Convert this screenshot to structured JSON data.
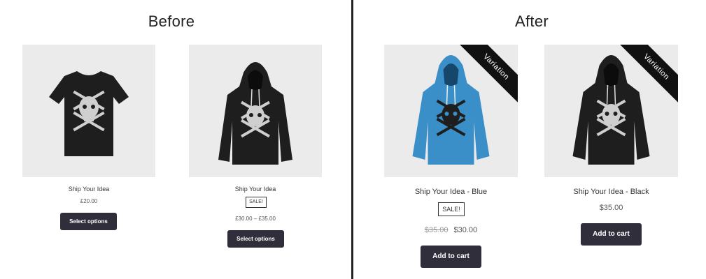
{
  "before": {
    "title": "Before",
    "products": [
      {
        "image": "tshirt-black",
        "name": "Ship Your Idea",
        "price": "£20.00",
        "button": "Select options"
      },
      {
        "image": "hoodie-black",
        "name": "Ship Your Idea",
        "sale_badge": "SALE!",
        "price": "£30.00 – £35.00",
        "button": "Select options"
      }
    ]
  },
  "after": {
    "title": "After",
    "products": [
      {
        "image": "hoodie-blue",
        "ribbon": "Variation",
        "name": "Ship Your Idea - Blue",
        "sale_badge": "SALE!",
        "old_price": "$35.00",
        "price": "$30.00",
        "button": "Add to cart"
      },
      {
        "image": "hoodie-black",
        "ribbon": "Variation",
        "name": "Ship Your Idea - Black",
        "price": "$35.00",
        "button": "Add to cart"
      }
    ]
  },
  "colors": {
    "button_bg": "#2f2e3a",
    "thumb_bg": "#ebebeb",
    "hoodie_blue": "#3b8fc8",
    "garment_black": "#1e1e1e"
  }
}
